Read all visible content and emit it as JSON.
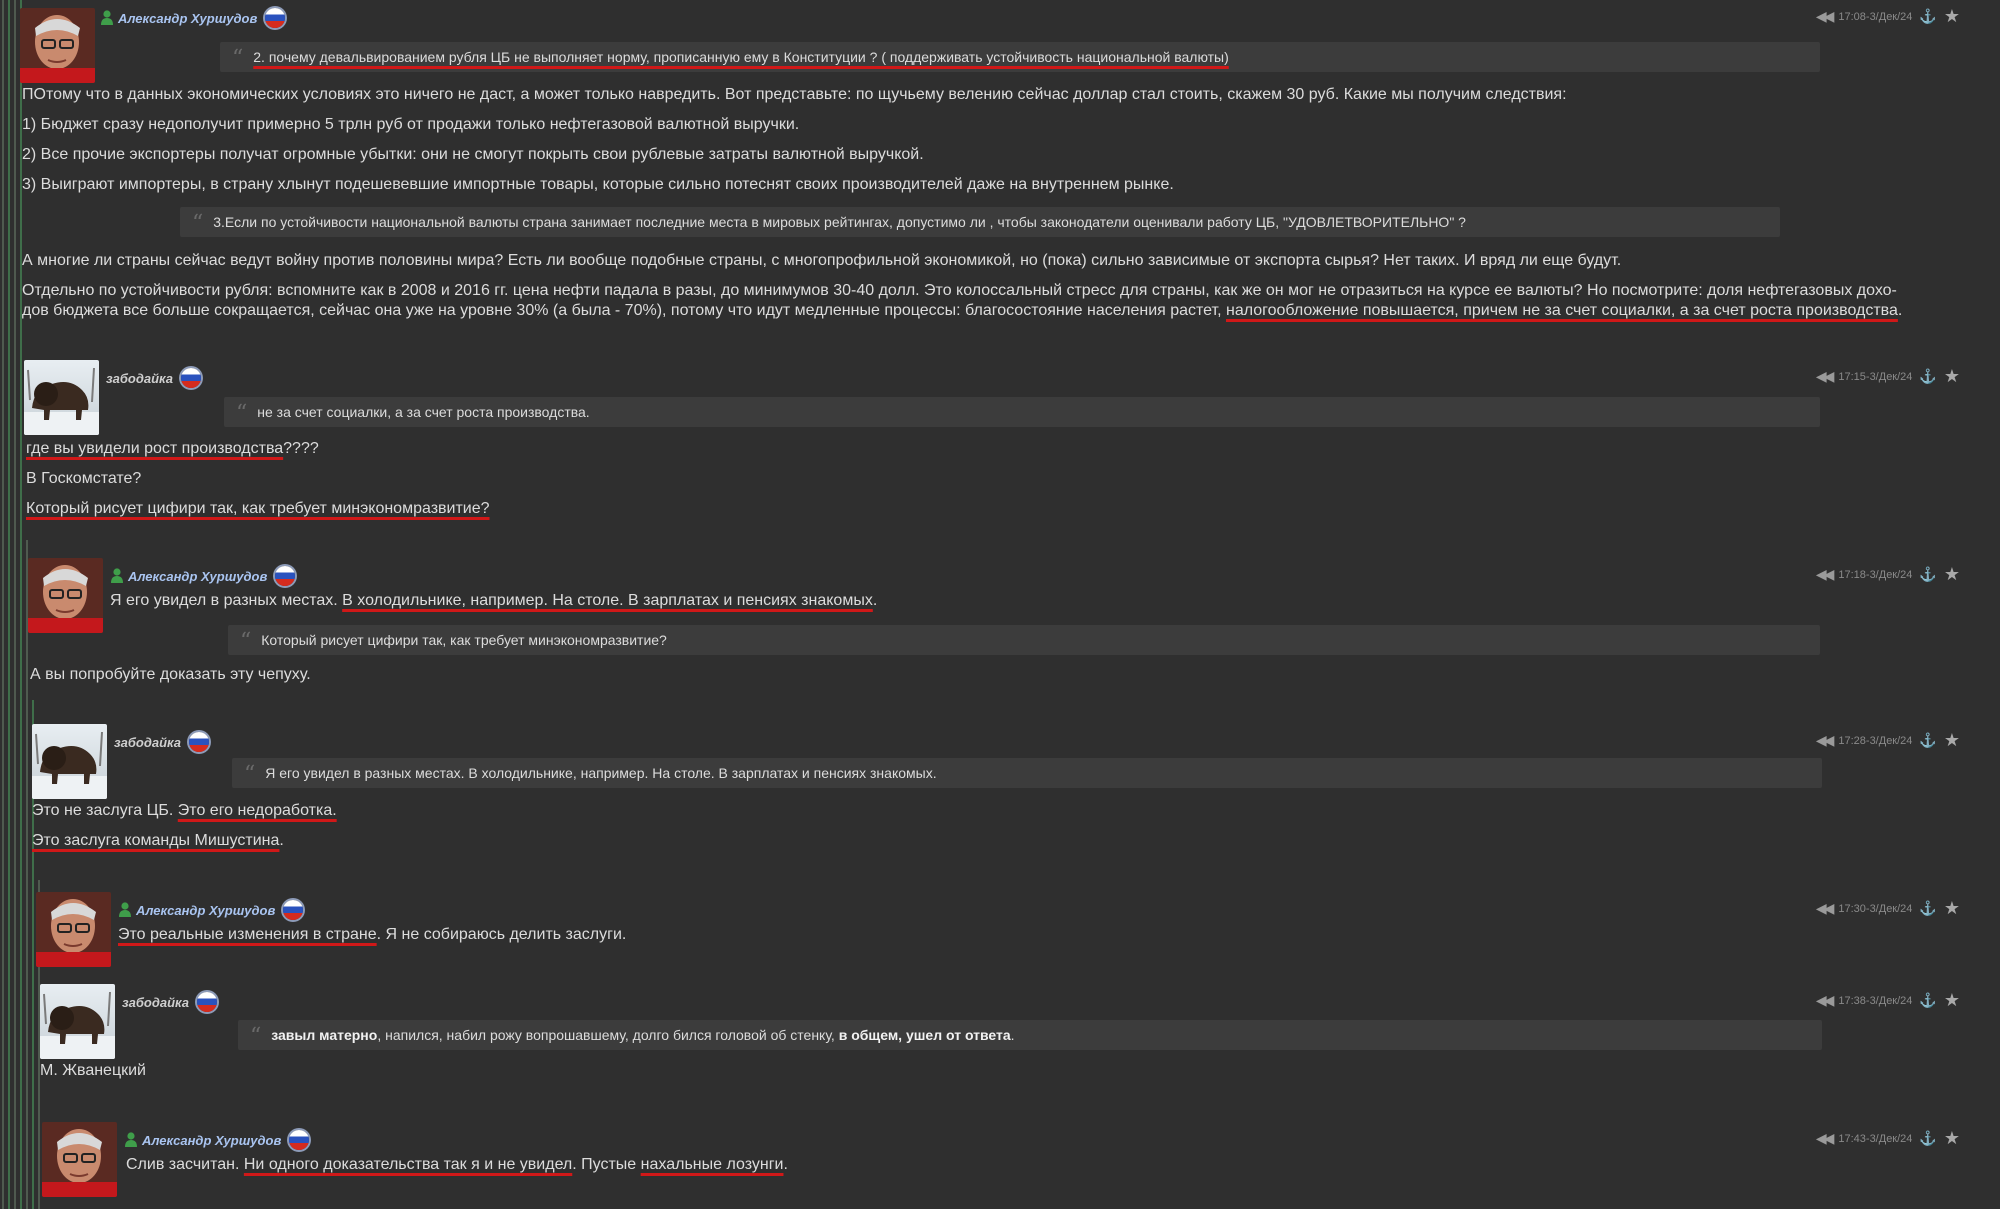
{
  "posts": [
    {
      "author": "Александр Хуршудов",
      "time": "17:08-3/Дек/24",
      "quote": "2. почему девальвированием рубля ЦБ не выполняет норму, прописанную ему в Конституции ? ( поддерживать устойчивость национальной валюты)",
      "lines": {
        "l1": "ПОтому что в данных экономических условиях это ничего не даст, а может только навредить.  Вот представьте: по щучьему велению сейчас доллар стал стоить, скажем 30 руб. Какие мы получим следствия:",
        "l2": "1) Бюджет сразу недополучит примерно 5 трлн руб от продажи только нефтегазовой валютной выручки.",
        "l3": "2) Все прочие экспортеры получат огромные убытки: они не смогут покрыть свои рублевые затраты валютной выручкой.",
        "l4": "3) Выиграют импортеры, в страну хлынут подешевевшие импортные товары, которые сильно потеснят своих производителей даже на внутреннем рынке."
      },
      "quote2": "3.Если по устойчивости национальной валюты страна занимает последние места в мировых рейтингах, допустимо ли , чтобы законодатели оценивали работу ЦБ,  \"УДОВЛЕТВОРИТЕЛЬНО\"  ?",
      "lines2": {
        "l5": "А многие ли страны сейчас ведут войну против половины мира?  Есть ли вообще подобные страны, с многопрофильной экономикой, но (пока) сильно зависимые от экспорта сырья? Нет таких. И вряд ли еще будут.",
        "l6": "Отдельно по устойчивости рубля: вспомните как в 2008 и 2016 гг. цена нефти падала в разы, до минимумов 30-40 долл. Это колоссальный стресс для страны, как же он мог не отразиться на курсе ее валюты? Но посмотрите: доля нефтегазовых дохо-",
        "l7a": "дов бюджета все больше сокращается, сейчас она уже на уровне 30% (а была - 70%), потому что идут медленные процессы: благосостояние населения растет, ",
        "l7b": "налогообложение повышается, причем не за счет социалки, а за счет роста производства",
        "l7c": "."
      }
    },
    {
      "author": "забодайка",
      "time": "17:15-3/Дек/24",
      "quote": "не за счет социалки, а за счет роста производства.",
      "l1a": "где вы увидели рост производства",
      "l1b": "????",
      "l2": "В Госкомстате?",
      "l3": "Который рисует цифири так, как требует  минэкономразвитие?"
    },
    {
      "author": "Александр Хуршудов",
      "time": "17:18-3/Дек/24",
      "l1a": "Я его увидел в разных местах. ",
      "l1b": "В холодильнике, например. На столе. В зарплатах и пенсиях знакомых",
      "l1c": ".",
      "quote": "Который рисует цифири так, как требует  минэкономразвитие?",
      "l2": "А вы попробуйте доказать эту чепуху."
    },
    {
      "author": "забодайка",
      "time": "17:28-3/Дек/24",
      "quote": "Я его увидел в разных местах. В холодильнике, например. На столе. В зарплатах и пенсиях знакомых.",
      "l1a": "Это не заслуга ЦБ.  ",
      "l1b": "Это его недоработка.",
      "l2a": "Это заслуга команды Мишустина",
      "l2b": "."
    },
    {
      "author": "Александр Хуршудов",
      "time": "17:30-3/Дек/24",
      "l1a": "Это реальные изменения в стране",
      "l1b": ". Я не собираюсь делить заслуги."
    },
    {
      "author": "забодайка",
      "time": "17:38-3/Дек/24",
      "q_b1": "завыл матерно",
      "q_t1": ", напился, набил рожу вопрошавшему, долго бился головой об стенку, ",
      "q_b2": "в общем,  ушел от ответа",
      "q_t2": ".",
      "l1": "М. Жванецкий"
    },
    {
      "author": "Александр Хуршудов",
      "time": "17:43-3/Дек/24",
      "l1a": "Слив засчитан. ",
      "l1b": "Ни одного доказательства так я и не увидел",
      "l1c": ". Пустые ",
      "l1d": "нахальные лозунги",
      "l1e": "."
    }
  ],
  "icons": {
    "back": "double-left-arrow-icon",
    "anchor": "anchor-icon",
    "star": "star-icon",
    "flag": "russia-flag-icon",
    "online": "person-online-icon"
  },
  "colors": {
    "background": "#2f2f2f",
    "quote_bg": "#3c3c3c",
    "author_link": "#a9c4f0",
    "underline": "#d01818",
    "online": "#3f9e4a"
  }
}
